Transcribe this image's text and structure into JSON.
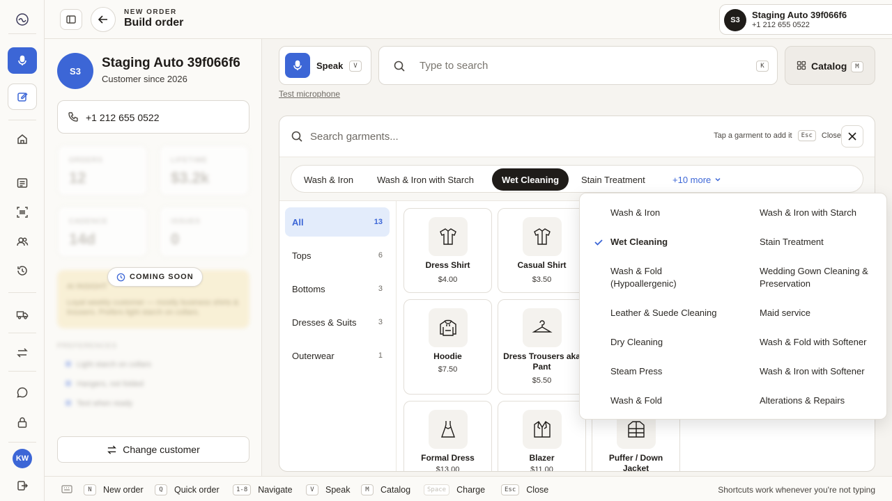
{
  "header": {
    "kicker": "NEW ORDER",
    "title": "Build order",
    "customer_chip": {
      "initials": "S3",
      "name": "Staging Auto 39f066f6",
      "phone": "+1 212 655 0522"
    }
  },
  "customer": {
    "initials": "S3",
    "name": "Staging Auto 39f066f6",
    "since": "Customer since 2026",
    "phone": "+1 212 655 0522",
    "stats": [
      {
        "label": "ORDERS",
        "value": "12"
      },
      {
        "label": "LIFETIME",
        "value": "$3.2k"
      },
      {
        "label": "CADENCE",
        "value": "14d"
      },
      {
        "label": "ISSUES",
        "value": "0"
      }
    ],
    "insight_title": "AI INSIGHT",
    "insight_text": "Loyal weekly customer — mostly business shirts & trousers. Prefers light starch on collars.",
    "preferences_title": "PREFERENCES",
    "preferences": [
      "Light starch on collars",
      "Hangers, not folded",
      "Text when ready"
    ],
    "coming_soon": "COMING SOON",
    "change_customer": "Change customer"
  },
  "rail": {
    "user_initials": "KW"
  },
  "toolbar": {
    "speak_label": "Speak",
    "speak_key": "V",
    "test_mic": "Test microphone",
    "search_placeholder": "Type to search",
    "search_key": "K",
    "catalog_label": "Catalog",
    "catalog_key": "M"
  },
  "panel": {
    "search_placeholder": "Search garments...",
    "hint_text": "Tap a garment to add it",
    "hint_key": "Esc",
    "hint_close": "Close",
    "tabs": [
      {
        "label": "Wash & Iron",
        "active": false
      },
      {
        "label": "Wash & Iron with Starch",
        "active": false
      },
      {
        "label": "Wet Cleaning",
        "active": true
      },
      {
        "label": "Stain Treatment",
        "active": false
      }
    ],
    "more_label": "+10 more",
    "categories": [
      {
        "label": "All",
        "count": "13",
        "active": true
      },
      {
        "label": "Tops",
        "count": "6",
        "active": false
      },
      {
        "label": "Bottoms",
        "count": "3",
        "active": false
      },
      {
        "label": "Dresses & Suits",
        "count": "3",
        "active": false
      },
      {
        "label": "Outerwear",
        "count": "1",
        "active": false
      }
    ],
    "garments": [
      {
        "name": "Dress Shirt",
        "price": "$4.00",
        "icon": "shirt-icon"
      },
      {
        "name": "Casual Shirt",
        "price": "$3.50",
        "icon": "shirt-icon"
      },
      {
        "name": "Hoodie",
        "price": "$7.50",
        "icon": "hoodie-icon"
      },
      {
        "name": "Dress Trousers aka Pant",
        "price": "$5.50",
        "icon": "hanger-icon"
      },
      {
        "name": "Formal Dress",
        "price": "$13.00",
        "icon": "dress-icon"
      },
      {
        "name": "Blazer",
        "price": "$11.00",
        "icon": "blazer-icon"
      },
      {
        "name": "Puffer / Down Jacket",
        "price": "",
        "icon": "jacket-icon"
      }
    ]
  },
  "service_dropdown": {
    "items": [
      {
        "label": "Wash & Iron",
        "selected": false
      },
      {
        "label": "Wash & Iron with Starch",
        "selected": false
      },
      {
        "label": "Wet Cleaning",
        "selected": true
      },
      {
        "label": "Stain Treatment",
        "selected": false
      },
      {
        "label": "Wash & Fold (Hypoallergenic)",
        "selected": false
      },
      {
        "label": "Wedding Gown Cleaning & Preservation",
        "selected": false
      },
      {
        "label": "Leather & Suede Cleaning",
        "selected": false
      },
      {
        "label": "Maid service",
        "selected": false
      },
      {
        "label": "Dry Cleaning",
        "selected": false
      },
      {
        "label": "Wash & Fold with Softener",
        "selected": false
      },
      {
        "label": "Steam Press",
        "selected": false
      },
      {
        "label": "Wash & Iron with Softener",
        "selected": false
      },
      {
        "label": "Wash & Fold",
        "selected": false
      },
      {
        "label": "Alterations & Repairs",
        "selected": false
      }
    ]
  },
  "shortcuts": {
    "items": [
      {
        "key": "N",
        "label": "New order"
      },
      {
        "key": "Q",
        "label": "Quick order"
      },
      {
        "key": "1-8",
        "label": "Navigate"
      },
      {
        "key": "V",
        "label": "Speak"
      },
      {
        "key": "M",
        "label": "Catalog"
      },
      {
        "key": "Space",
        "label": "Charge"
      },
      {
        "key": "Esc",
        "label": "Close"
      }
    ],
    "note": "Shortcuts work whenever you're not typing"
  },
  "colors": {
    "accent": "#3c66d6",
    "dark": "#1f1c19",
    "soon_bg": "#f8ecc9"
  }
}
